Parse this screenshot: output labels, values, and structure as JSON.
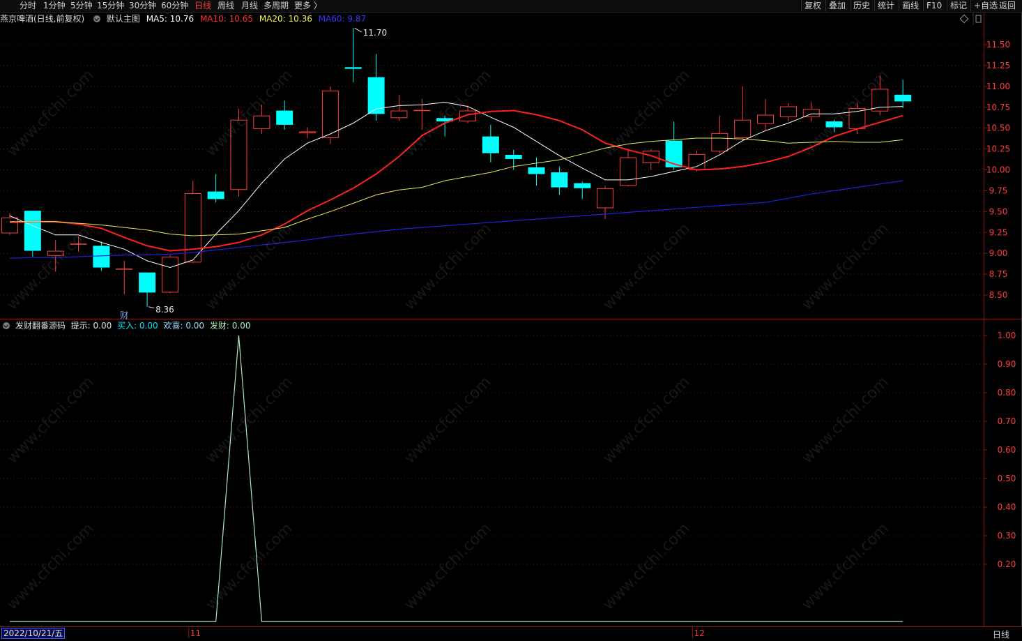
{
  "toolbar": {
    "periods": [
      "分时",
      "1分钟",
      "5分钟",
      "15分钟",
      "30分钟",
      "60分钟",
      "日线",
      "周线",
      "月线",
      "多周期",
      "更多 〉"
    ],
    "active_period": "日线",
    "buttons": [
      "复权",
      "叠加",
      "历史",
      "统计",
      "画线",
      "F10",
      "标记",
      "+自选",
      "返回"
    ]
  },
  "main_header": {
    "stock": "燕京啤酒(日线,前复权)",
    "template": "默认主图",
    "ma5": "MA5: 10.76",
    "ma10": "MA10: 10.65",
    "ma20": "MA20: 10.36",
    "ma60": "MA60: 9.87"
  },
  "indicator_header": {
    "name": "发财翻番源码",
    "tip": "提示: 0.00",
    "buy": "买入: 0.00",
    "joy": "欢喜: 0.00",
    "fortune": "发财: 0.00"
  },
  "colors": {
    "up": "#ff3c3c",
    "down": "#00ffff",
    "ma5": "#ffffff",
    "ma10": "#ff2020",
    "ma20": "#e8e860",
    "ma60": "#2020e0",
    "indicator_line": "#b0e8c0",
    "grid": "#7a1010"
  },
  "chart_data": [
    {
      "type": "candlestick",
      "title": "燕京啤酒(日线,前复权)",
      "y_axis_ticks": [
        "11.50",
        "11.25",
        "11.00",
        "10.75",
        "10.50",
        "10.25",
        "10.00",
        "9.75",
        "9.50",
        "9.25",
        "9.00",
        "8.75",
        "8.50"
      ],
      "ylim": [
        8.3,
        11.85
      ],
      "annotations": [
        {
          "label": "11.70",
          "note": "high"
        },
        {
          "label": "8.36",
          "note": "low"
        },
        {
          "label": "财",
          "note": "marker"
        }
      ],
      "candles": [
        {
          "o": 9.24,
          "h": 9.48,
          "l": 9.22,
          "c": 9.43
        },
        {
          "o": 9.51,
          "h": 9.51,
          "l": 8.96,
          "c": 9.03
        },
        {
          "o": 8.97,
          "h": 9.16,
          "l": 8.78,
          "c": 9.03
        },
        {
          "o": 9.11,
          "h": 9.2,
          "l": 9.02,
          "c": 9.11
        },
        {
          "o": 9.09,
          "h": 9.14,
          "l": 8.79,
          "c": 8.83
        },
        {
          "o": 8.81,
          "h": 8.91,
          "l": 8.51,
          "c": 8.81
        },
        {
          "o": 8.77,
          "h": 8.77,
          "l": 8.36,
          "c": 8.53
        },
        {
          "o": 8.53,
          "h": 8.98,
          "l": 8.52,
          "c": 8.96
        },
        {
          "o": 8.89,
          "h": 9.87,
          "l": 8.88,
          "c": 9.72
        },
        {
          "o": 9.74,
          "h": 9.95,
          "l": 9.61,
          "c": 9.65
        },
        {
          "o": 9.76,
          "h": 10.73,
          "l": 9.68,
          "c": 10.6
        },
        {
          "o": 10.49,
          "h": 10.78,
          "l": 10.43,
          "c": 10.65
        },
        {
          "o": 10.71,
          "h": 10.83,
          "l": 10.48,
          "c": 10.54
        },
        {
          "o": 10.44,
          "h": 10.51,
          "l": 10.38,
          "c": 10.46
        },
        {
          "o": 10.38,
          "h": 11.0,
          "l": 10.31,
          "c": 10.95
        },
        {
          "o": 11.23,
          "h": 11.7,
          "l": 11.05,
          "c": 11.21
        },
        {
          "o": 11.11,
          "h": 11.39,
          "l": 10.59,
          "c": 10.67
        },
        {
          "o": 10.62,
          "h": 10.9,
          "l": 10.59,
          "c": 10.71
        },
        {
          "o": 10.71,
          "h": 10.85,
          "l": 10.48,
          "c": 10.71
        },
        {
          "o": 10.62,
          "h": 10.65,
          "l": 10.4,
          "c": 10.58
        },
        {
          "o": 10.58,
          "h": 10.77,
          "l": 10.56,
          "c": 10.71
        },
        {
          "o": 10.4,
          "h": 10.54,
          "l": 10.09,
          "c": 10.2
        },
        {
          "o": 10.18,
          "h": 10.24,
          "l": 10.0,
          "c": 10.13
        },
        {
          "o": 10.03,
          "h": 10.15,
          "l": 9.81,
          "c": 9.95
        },
        {
          "o": 9.97,
          "h": 10.04,
          "l": 9.7,
          "c": 9.79
        },
        {
          "o": 9.84,
          "h": 9.86,
          "l": 9.65,
          "c": 9.78
        },
        {
          "o": 9.54,
          "h": 9.81,
          "l": 9.41,
          "c": 9.78
        },
        {
          "o": 9.81,
          "h": 10.24,
          "l": 9.8,
          "c": 10.15
        },
        {
          "o": 10.08,
          "h": 10.25,
          "l": 10.0,
          "c": 10.23
        },
        {
          "o": 10.35,
          "h": 10.58,
          "l": 10.0,
          "c": 10.03
        },
        {
          "o": 10.0,
          "h": 10.23,
          "l": 9.98,
          "c": 10.19
        },
        {
          "o": 10.22,
          "h": 10.65,
          "l": 10.2,
          "c": 10.44
        },
        {
          "o": 10.38,
          "h": 11.0,
          "l": 10.35,
          "c": 10.6
        },
        {
          "o": 10.55,
          "h": 10.85,
          "l": 10.48,
          "c": 10.66
        },
        {
          "o": 10.63,
          "h": 10.8,
          "l": 10.58,
          "c": 10.76
        },
        {
          "o": 10.63,
          "h": 10.81,
          "l": 10.58,
          "c": 10.73
        },
        {
          "o": 10.58,
          "h": 10.6,
          "l": 10.45,
          "c": 10.51
        },
        {
          "o": 10.49,
          "h": 10.81,
          "l": 10.43,
          "c": 10.74
        },
        {
          "o": 10.7,
          "h": 11.13,
          "l": 10.65,
          "c": 10.97
        },
        {
          "o": 10.9,
          "h": 11.08,
          "l": 10.74,
          "c": 10.82
        }
      ],
      "series": [
        {
          "name": "MA5",
          "values": [
            9.45,
            9.33,
            9.22,
            9.22,
            9.13,
            9.05,
            8.91,
            8.83,
            8.92,
            9.23,
            9.51,
            9.84,
            10.13,
            10.32,
            10.43,
            10.56,
            10.73,
            10.77,
            10.78,
            10.81,
            10.76,
            10.63,
            10.51,
            10.34,
            10.17,
            10.02,
            9.88,
            9.88,
            9.92,
            9.98,
            10.04,
            10.18,
            10.35,
            10.47,
            10.56,
            10.67,
            10.67,
            10.7,
            10.75,
            10.76
          ]
        },
        {
          "name": "MA10",
          "values": [
            9.37,
            9.38,
            9.38,
            9.35,
            9.3,
            9.19,
            9.09,
            9.03,
            9.05,
            9.08,
            9.13,
            9.22,
            9.35,
            9.51,
            9.64,
            9.78,
            9.95,
            10.16,
            10.41,
            10.56,
            10.66,
            10.7,
            10.71,
            10.66,
            10.59,
            10.48,
            10.32,
            10.24,
            10.17,
            10.07,
            10.0,
            10.01,
            10.04,
            10.09,
            10.16,
            10.27,
            10.4,
            10.49,
            10.57,
            10.65
          ]
        },
        {
          "name": "MA20",
          "values": [
            9.38,
            9.38,
            9.38,
            9.36,
            9.34,
            9.31,
            9.28,
            9.23,
            9.21,
            9.22,
            9.23,
            9.27,
            9.31,
            9.41,
            9.5,
            9.6,
            9.7,
            9.76,
            9.79,
            9.87,
            9.92,
            9.97,
            10.04,
            10.08,
            10.12,
            10.19,
            10.26,
            10.31,
            10.34,
            10.36,
            10.38,
            10.38,
            10.37,
            10.35,
            10.32,
            10.33,
            10.34,
            10.33,
            10.33,
            10.36
          ]
        },
        {
          "name": "MA60",
          "values": [
            8.94,
            8.95,
            8.95,
            8.96,
            8.97,
            8.98,
            8.98,
            8.99,
            9.01,
            9.04,
            9.07,
            9.1,
            9.13,
            9.16,
            9.2,
            9.23,
            9.26,
            9.29,
            9.31,
            9.33,
            9.35,
            9.37,
            9.39,
            9.41,
            9.43,
            9.45,
            9.47,
            9.49,
            9.51,
            9.53,
            9.55,
            9.57,
            9.59,
            9.61,
            9.66,
            9.71,
            9.75,
            9.79,
            9.83,
            9.87
          ]
        }
      ],
      "x_labels": [
        {
          "index": 0,
          "label": "2022/10/21/五"
        },
        {
          "index": 8,
          "label": "11"
        },
        {
          "index": 30,
          "label": "12"
        }
      ]
    },
    {
      "type": "line",
      "title": "发财翻番源码",
      "y_axis_ticks": [
        "1.00",
        "0.90",
        "0.80",
        "0.70",
        "0.60",
        "0.50",
        "0.40",
        "0.30",
        "0.20"
      ],
      "ylim": [
        0.0,
        1.035
      ],
      "series": [
        {
          "name": "发财",
          "values": [
            0,
            0,
            0,
            0,
            0,
            0,
            0,
            0,
            0,
            0,
            1,
            0,
            0,
            0,
            0,
            0,
            0,
            0,
            0,
            0,
            0,
            0,
            0,
            0,
            0,
            0,
            0,
            0,
            0,
            0,
            0,
            0,
            0,
            0,
            0,
            0,
            0,
            0,
            0,
            0
          ]
        }
      ]
    }
  ],
  "period_label": "日线",
  "watermark": "www.cfchi.com"
}
